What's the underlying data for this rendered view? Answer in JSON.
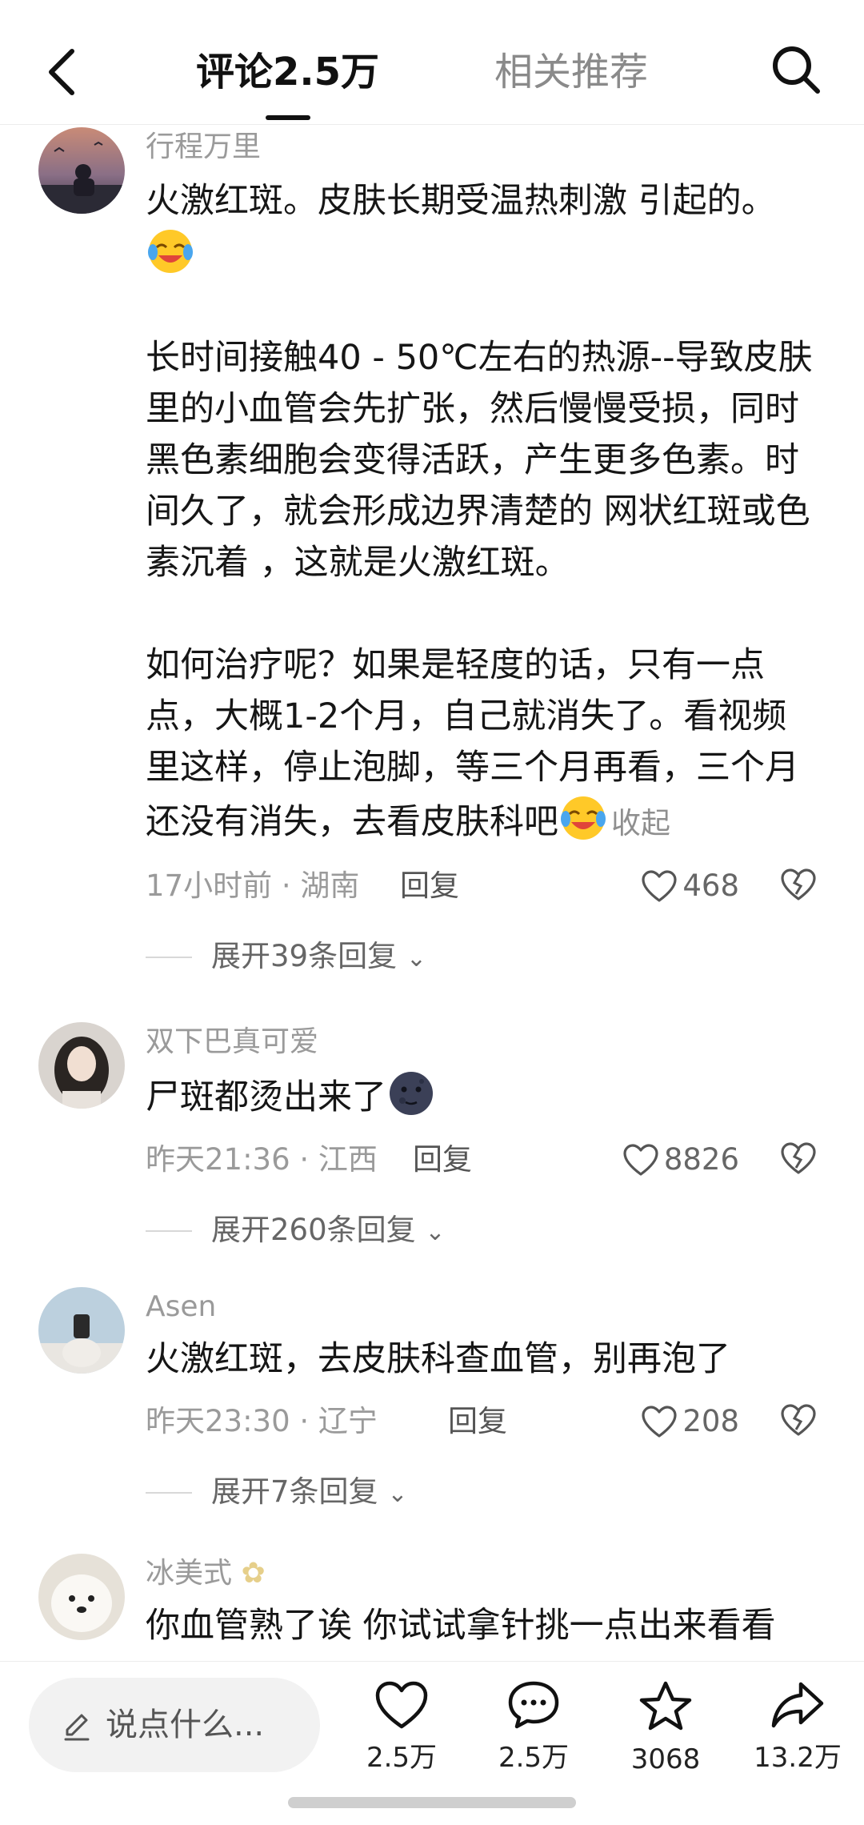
{
  "header": {
    "tab_comments": "评论2.5万",
    "tab_related": "相关推荐"
  },
  "comments": [
    {
      "username": "行程万里",
      "paragraphs": [
        "火激红斑。皮肤长期受温热刺激 引起的。",
        "长时间接触40 - 50℃左右的热源--导致皮肤里的小血管会先扩张，然后慢慢受损，同时黑色素细胞会变得活跃，产生更多色素。时间久了，就会形成边界清楚的 网状红斑或色素沉着 ，这就是火激红斑。",
        "如何治疗呢？如果是轻度的话，只有一点点，大概1-2个月，自己就消失了。看视频里这样，停止泡脚，等三个月再看，三个月还没有消失，去看皮肤科吧"
      ],
      "collapse_label": "收起",
      "time_location": "17小时前 · 湖南",
      "reply_label": "回复",
      "likes": "468",
      "expand_label": "展开39条回复"
    },
    {
      "username": "双下巴真可爱",
      "text": "尸斑都烫出来了",
      "time_location": "昨天21:36 · 江西",
      "reply_label": "回复",
      "likes": "8826",
      "expand_label": "展开260条回复"
    },
    {
      "username": "Asen",
      "text": "火激红斑，去皮肤科查血管，别再泡了",
      "time_location": "昨天23:30 · 辽宁",
      "reply_label": "回复",
      "likes": "208",
      "expand_label": "展开7条回复"
    },
    {
      "username": "冰美式",
      "text": "你血管熟了诶 你试试拿针挑一点出来看看"
    }
  ],
  "bottom_bar": {
    "input_placeholder": "说点什么...",
    "like_count": "2.5万",
    "comment_count": "2.5万",
    "favorite_count": "3068",
    "share_count": "13.2万"
  },
  "icons": {
    "back": "chevron-left-icon",
    "search": "search-icon",
    "like": "heart-outline-icon",
    "dislike": "broken-heart-icon",
    "pencil": "pencil-icon",
    "comment": "comment-bubble-icon",
    "favorite": "star-outline-icon",
    "share": "share-arrow-icon"
  },
  "colors": {
    "text_primary": "#161616",
    "text_secondary": "#9a9a9a",
    "background": "#ffffff",
    "input_bg": "#f2f2f2"
  }
}
